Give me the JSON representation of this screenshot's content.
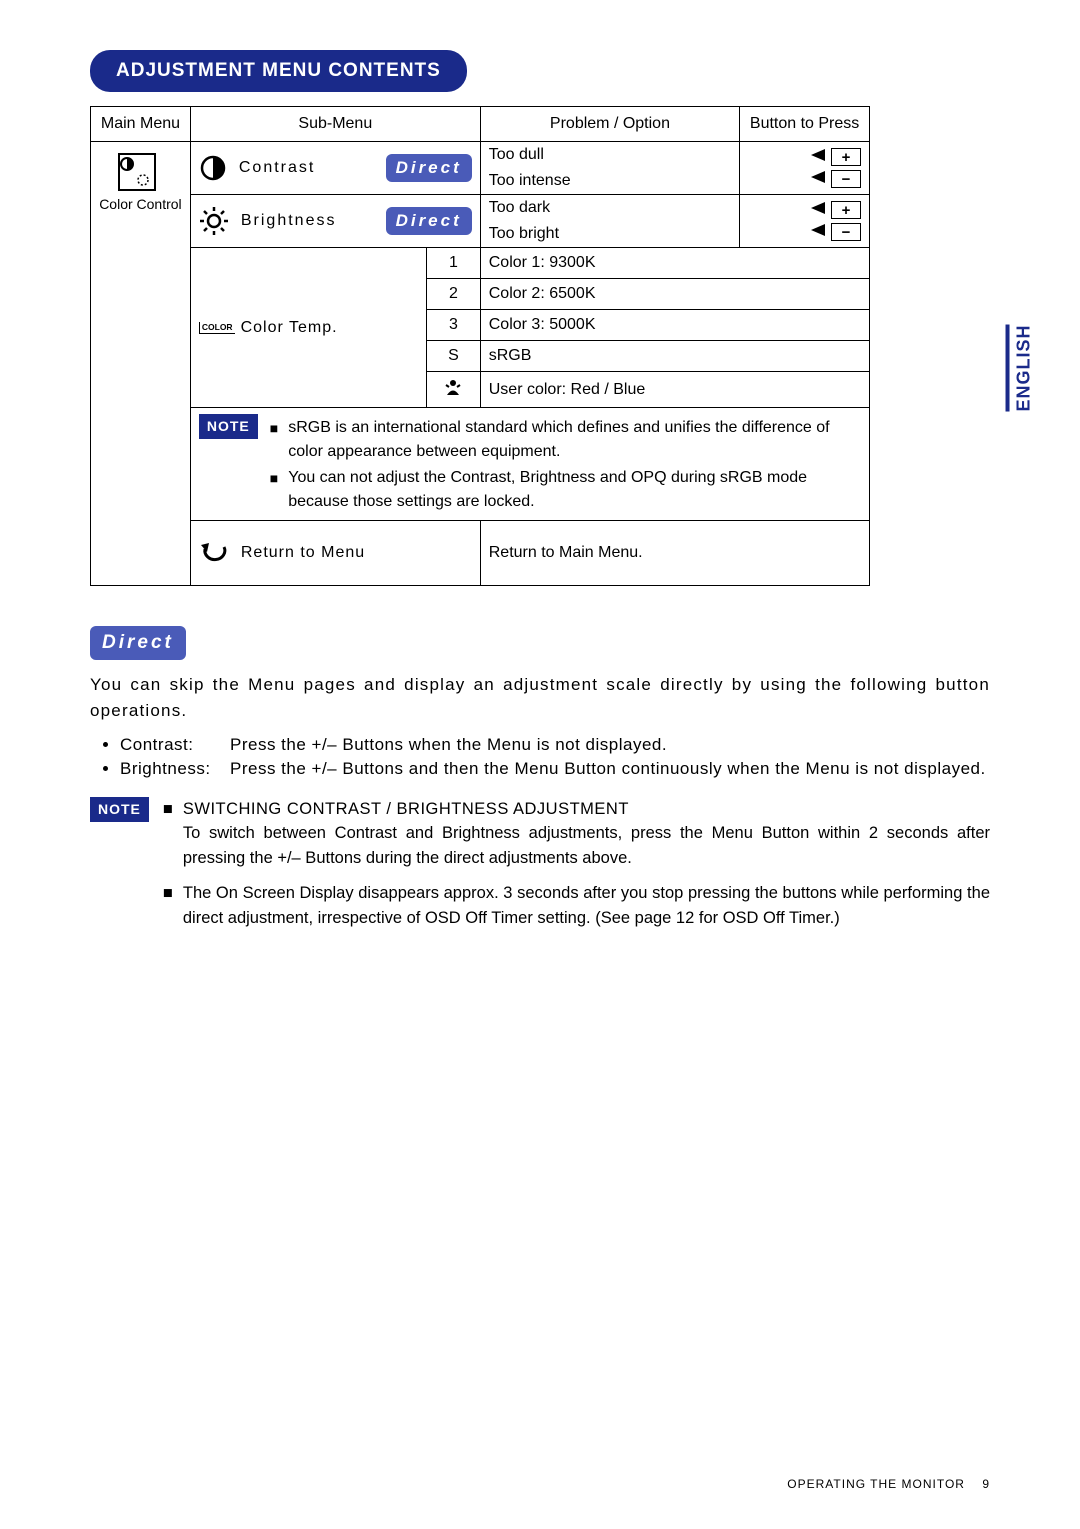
{
  "title": "ADJUSTMENT MENU CONTENTS",
  "side_tab": "ENGLISH",
  "headers": {
    "main": "Main Menu",
    "sub": "Sub-Menu",
    "problem": "Problem / Option",
    "button": "Button to Press"
  },
  "main_menu_label": "Color Control",
  "rows": {
    "contrast": {
      "label": "Contrast",
      "badge": "Direct",
      "opt1": "Too dull",
      "opt2": "Too intense",
      "btn1": "+",
      "btn2": "−"
    },
    "brightness": {
      "label": "Brightness",
      "badge": "Direct",
      "opt1": "Too dark",
      "opt2": "Too bright",
      "btn1": "+",
      "btn2": "−"
    },
    "colortemp": {
      "box": "COLOR",
      "label": "Color Temp.",
      "items": [
        {
          "key": "1",
          "val": "Color 1: 9300K"
        },
        {
          "key": "2",
          "val": "Color 2: 6500K"
        },
        {
          "key": "3",
          "val": "Color 3: 5000K"
        },
        {
          "key": "S",
          "val": "sRGB"
        },
        {
          "key": "person",
          "val": "User color: Red / Blue"
        }
      ]
    },
    "note_badge": "NOTE",
    "note_b1": "sRGB is an international standard which defines and unifies the difference of color appearance between equipment.",
    "note_b2": "You can not adjust the Contrast, Brightness and OPQ during sRGB mode because those settings are locked.",
    "return_label": "Return to Menu",
    "return_desc": "Return to Main Menu."
  },
  "direct": {
    "badge": "Direct",
    "intro": "You can skip the Menu pages and display an adjustment scale directly by using the following button operations.",
    "items": [
      {
        "term": "Contrast:",
        "desc": "Press the +/– Buttons when the Menu is not displayed."
      },
      {
        "term": "Brightness:",
        "desc": "Press the +/– Buttons and then the Menu Button continuously when the Menu is not displayed."
      }
    ],
    "note_badge": "NOTE",
    "switching_title": "SWITCHING CONTRAST / BRIGHTNESS ADJUSTMENT",
    "switching_body": "To switch between Contrast and Brightness adjustments, press the Menu Button within 2 seconds after pressing the +/– Buttons during the direct adjustments above.",
    "osd_body": "The On Screen Display disappears approx. 3 seconds after you stop pressing the buttons while performing the direct adjustment, irrespective of OSD Off Timer setting. (See page 12 for OSD Off Timer.)"
  },
  "footer": {
    "label": "OPERATING THE MONITOR",
    "page": "9"
  }
}
